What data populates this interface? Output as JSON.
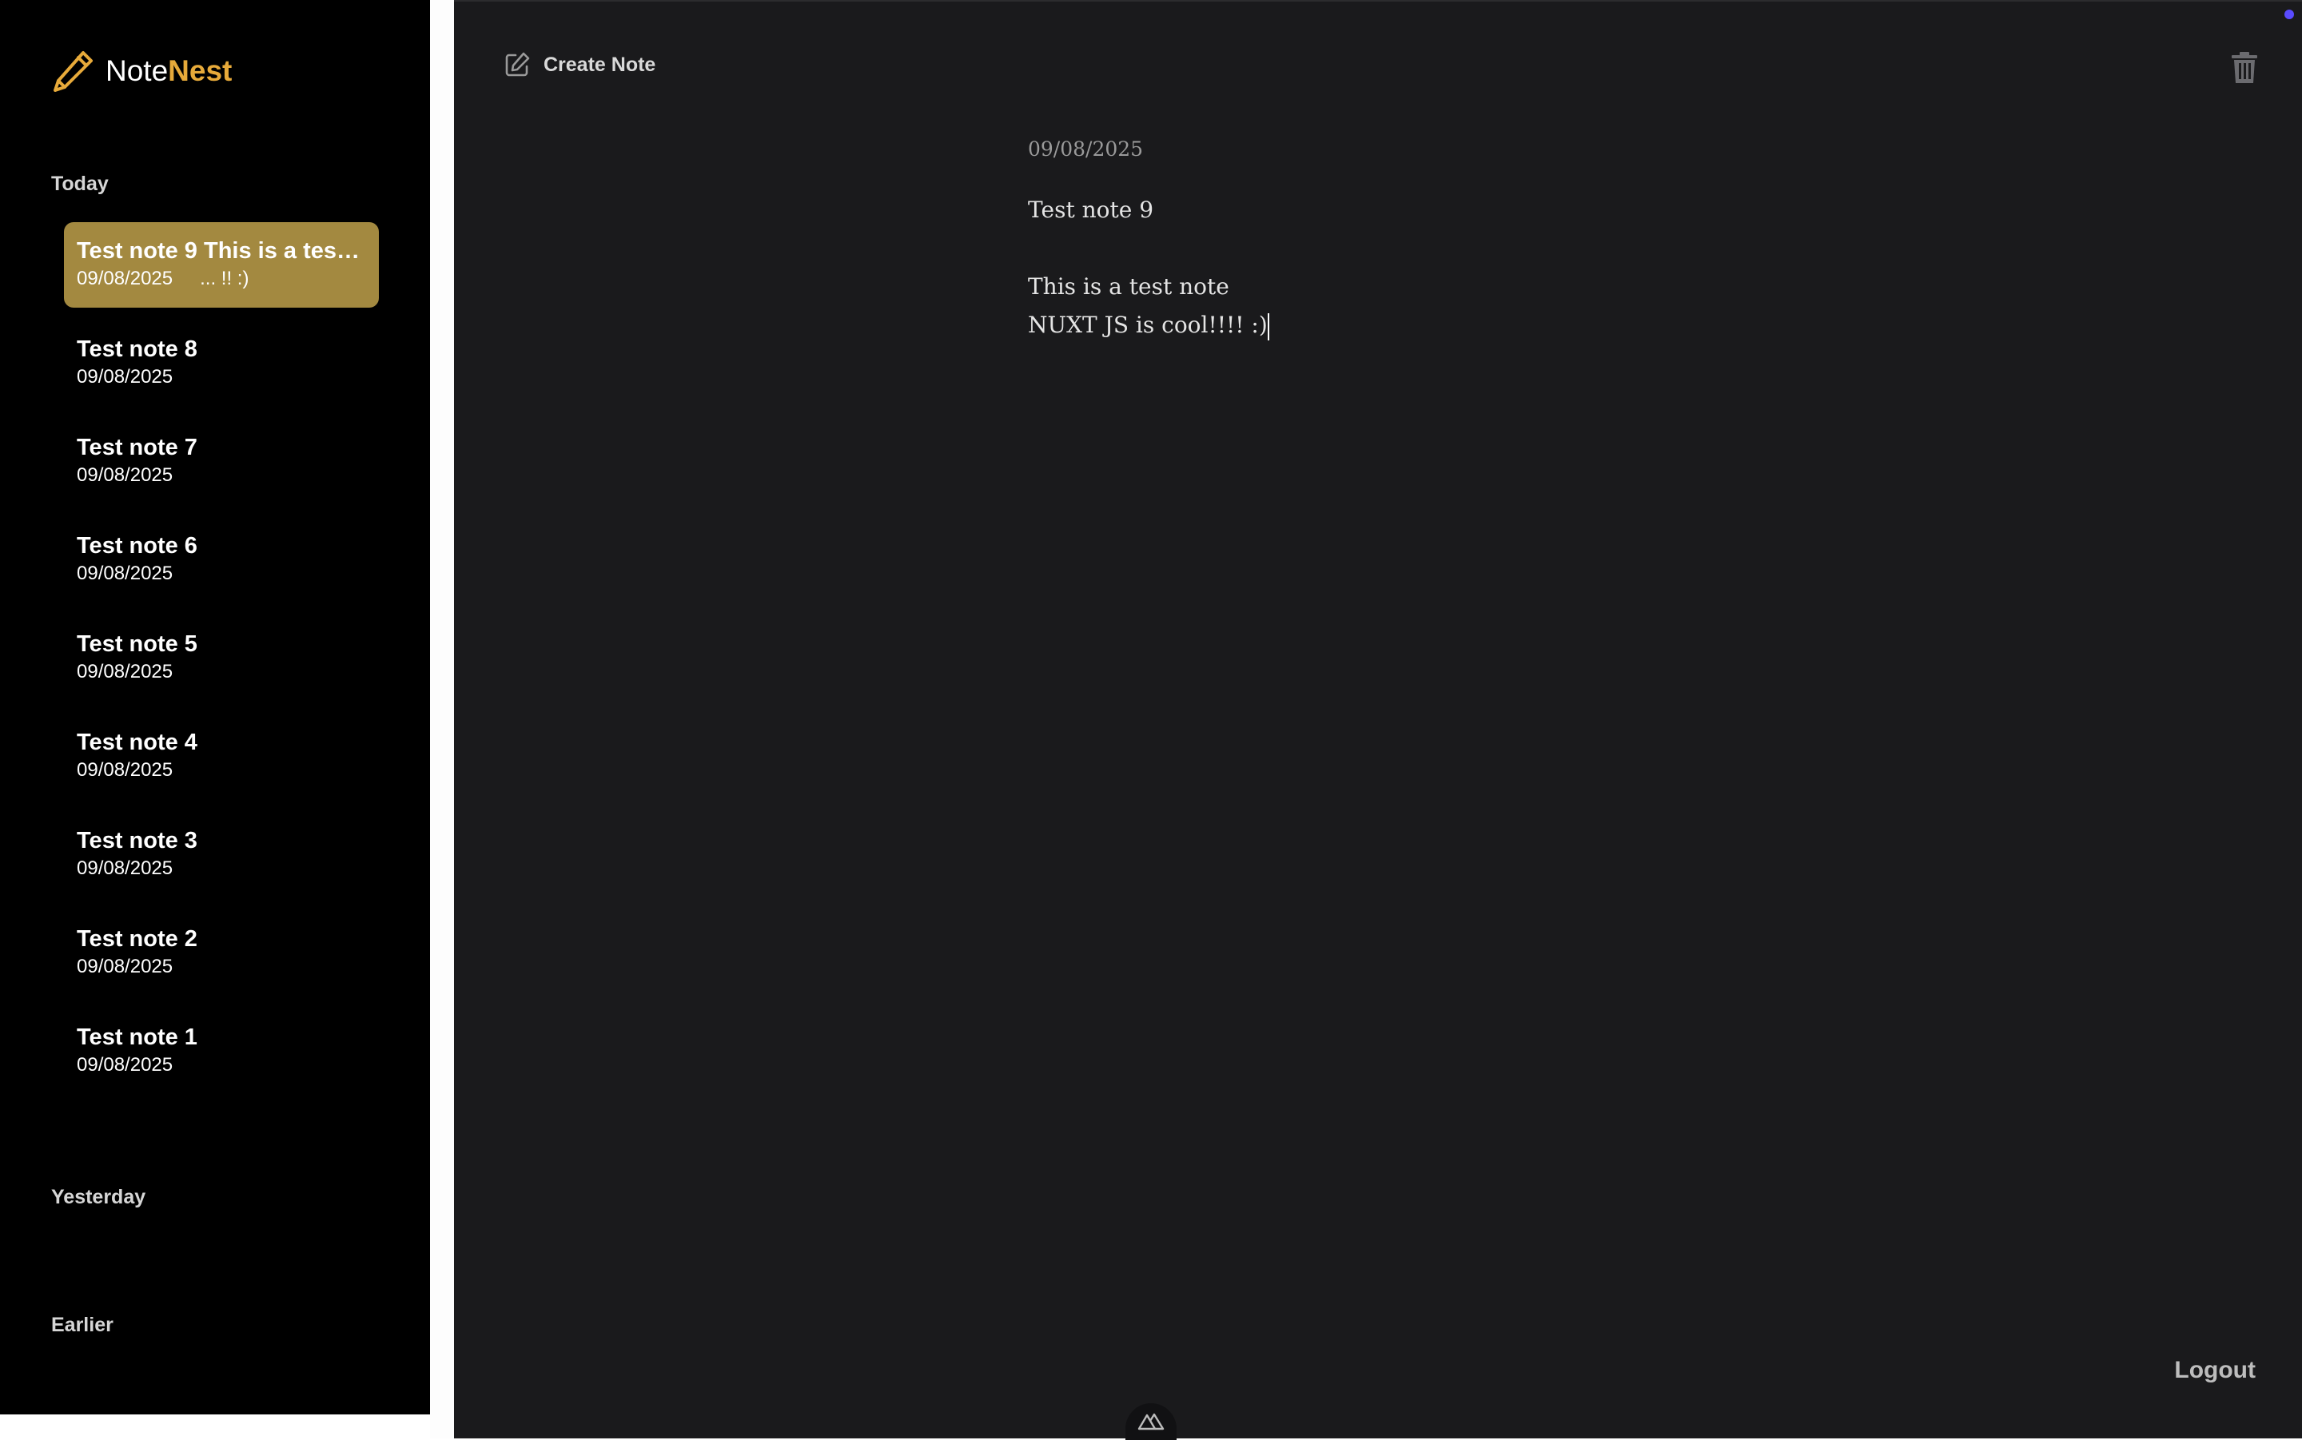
{
  "brand": {
    "name_part1": "Note",
    "name_part2": "Nest",
    "icon": "pencil-icon",
    "accent_color": "#e7aa3a"
  },
  "sidebar": {
    "groups": {
      "today": "Today",
      "yesterday": "Yesterday",
      "earlier": "Earlier"
    },
    "notes": [
      {
        "title": "Test note 9 This is a test note NUXT JS is cool!!!! :)",
        "date": "09/08/2025",
        "preview": "... !! :)",
        "active": true
      },
      {
        "title": "Test note 8",
        "date": "09/08/2025"
      },
      {
        "title": "Test note 7",
        "date": "09/08/2025"
      },
      {
        "title": "Test note 6",
        "date": "09/08/2025"
      },
      {
        "title": "Test note 5",
        "date": "09/08/2025"
      },
      {
        "title": "Test note 4",
        "date": "09/08/2025"
      },
      {
        "title": "Test note 3",
        "date": "09/08/2025"
      },
      {
        "title": "Test note 2",
        "date": "09/08/2025"
      },
      {
        "title": "Test note 1",
        "date": "09/08/2025"
      }
    ],
    "active_color": "#a38940"
  },
  "toolbar": {
    "create_label": "Create Note",
    "create_icon": "edit-icon",
    "delete_icon": "trash-icon"
  },
  "editor": {
    "date": "09/08/2025",
    "lines": [
      "Test note 9",
      "",
      "This is a test note",
      "NUXT JS is cool!!!! :)"
    ]
  },
  "footer": {
    "logout_label": "Logout",
    "devtools_icon": "nuxt-icon"
  }
}
